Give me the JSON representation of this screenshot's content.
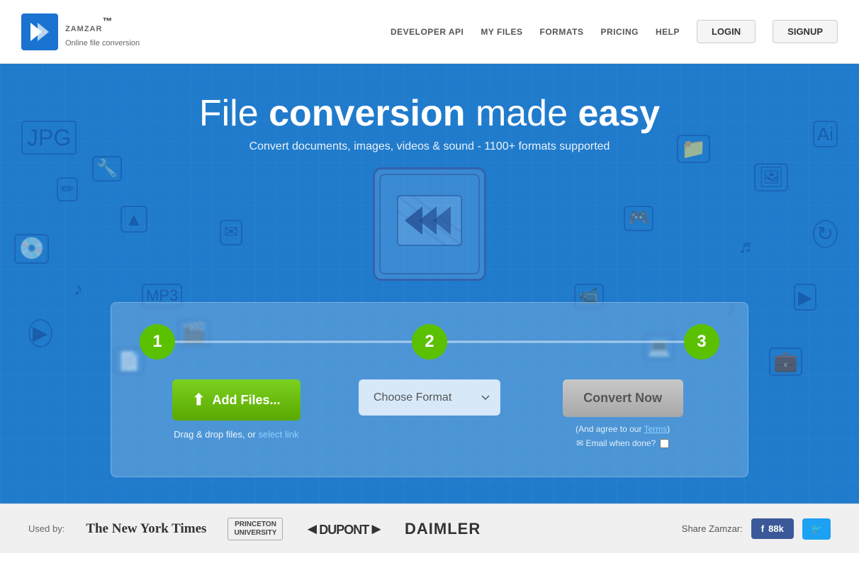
{
  "header": {
    "logo_text": "ZAMZAR",
    "logo_tm": "™",
    "logo_subtitle": "Online file conversion",
    "nav": {
      "developer_api": "DEVELOPER API",
      "my_files": "MY FILES",
      "formats": "FORMATS",
      "pricing": "PRICING",
      "help": "HELP",
      "login": "LOGIN",
      "signup": "SIGNUP"
    }
  },
  "hero": {
    "title_plain": "File ",
    "title_bold1": "conversion",
    "title_plain2": " made ",
    "title_bold2": "easy",
    "subtitle": "Convert documents, images, videos & sound - 1100+ formats supported"
  },
  "steps": {
    "step1_label": "1",
    "step2_label": "2",
    "step3_label": "3"
  },
  "actions": {
    "add_files_label": "Add Files...",
    "drag_drop_text": "Drag & drop files, or ",
    "select_link": "select link",
    "choose_format_label": "Choose Format",
    "choose_format_placeholder": "Choose Format",
    "convert_now_label": "Convert Now",
    "terms_text": "(And agree to our ",
    "terms_link": "Terms",
    "terms_close": ")",
    "email_label": "✉ Email when done?"
  },
  "footer": {
    "used_by_label": "Used by:",
    "brand1": "The New York Times",
    "brand2_line1": "PRINCETON",
    "brand2_line2": "UNIVERSITY",
    "brand3": "◄DUPONT►",
    "brand4": "DAIMLER",
    "share_label": "Share Zamzar:",
    "fb_label": "f  88k",
    "twitter_icon": "🐦"
  }
}
